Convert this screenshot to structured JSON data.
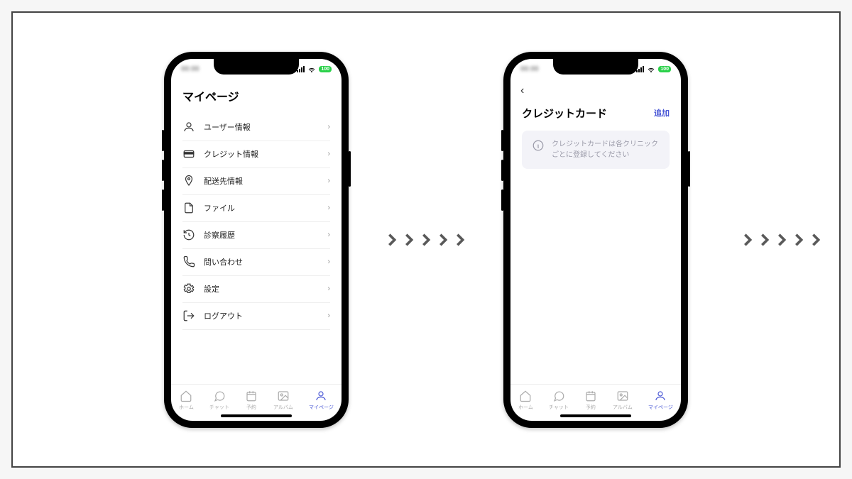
{
  "status": {
    "battery": "100"
  },
  "screen1": {
    "title": "マイページ",
    "menu": [
      {
        "label": "ユーザー情報"
      },
      {
        "label": "クレジット情報"
      },
      {
        "label": "配送先情報"
      },
      {
        "label": "ファイル"
      },
      {
        "label": "診察履歴"
      },
      {
        "label": "問い合わせ"
      },
      {
        "label": "設定"
      },
      {
        "label": "ログアウト"
      }
    ]
  },
  "screen2": {
    "title": "クレジットカード",
    "add_label": "追加",
    "info_message": "クレジットカードは各クリニックごとに登録してください"
  },
  "tabs": [
    {
      "label": "ホーム"
    },
    {
      "label": "チャット"
    },
    {
      "label": "予約"
    },
    {
      "label": "アルバム"
    },
    {
      "label": "マイページ"
    }
  ]
}
